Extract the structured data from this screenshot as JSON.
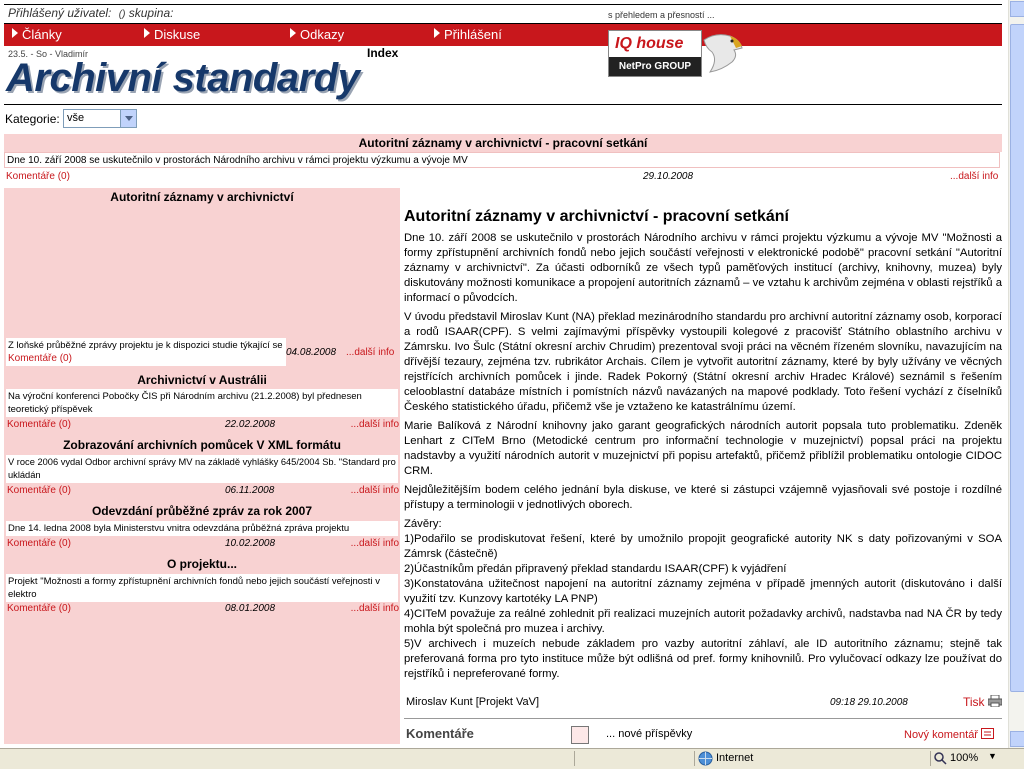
{
  "topbar": {
    "user_label": "Přihlášený uživatel:",
    "user_value": "()",
    "group_label": "skupina:",
    "motto": "s přehledem a přesností ..."
  },
  "nav": {
    "items": [
      "Články",
      "Diskuse",
      "Odkazy",
      "Přihlášení"
    ]
  },
  "header": {
    "date": "23.5. - So - Vladimír",
    "index_label": "Index",
    "title": "Archivní standardy"
  },
  "logo": {
    "brand": "IQ house",
    "sub": "NetPro GROUP"
  },
  "category": {
    "label": "Kategorie:",
    "selected": "vše"
  },
  "main_entry": {
    "title": "Autoritní záznamy v archivnictví - pracovní setkání",
    "snippet": "Dne 10. září 2008 se uskutečnilo v prostorách Národního archivu v rámci projektu výzkumu a vývoje MV",
    "comments": "Komentáře (0)",
    "date": "29.10.2008",
    "more": "...další info"
  },
  "left_entries": [
    {
      "title": "Autoritní záznamy v archivnictví",
      "snippet": "Z loňské průběžné zprávy projektu je k dispozici studie týkající se",
      "comments": "Komentáře (0)",
      "date": "04.08.2008",
      "more": "...další info"
    },
    {
      "title": "Archivnictví v Austrálii",
      "snippet": "Na výroční konferenci Pobočky ČIS při Národním archivu (21.2.2008) byl přednesen teoretický příspěvek",
      "comments": "Komentáře (0)",
      "date": "22.02.2008",
      "more": "...další info"
    },
    {
      "title": "Zobrazování archivních pomůcek V XML formátu",
      "snippet": "V roce 2006 vydal Odbor archivní správy MV na základě vyhlášky 645/2004 Sb. \"Standard pro ukládán",
      "comments": "Komentáře (0)",
      "date": "06.11.2008",
      "more": "...další info"
    },
    {
      "title": "Odevzdání průběžné zpráv za rok 2007",
      "snippet": "Dne 14. ledna 2008 byla Ministerstvu vnitra odevzdána průběžná zpráva projektu",
      "comments": "Komentáře (0)",
      "date": "10.02.2008",
      "more": "...další info"
    },
    {
      "title": "O projektu...",
      "snippet": "Projekt \"Možnosti a formy zpřístupnění archivních fondů nebo jejich součástí veřejnosti v elektro",
      "comments": "Komentáře (0)",
      "date": "08.01.2008",
      "more": "...další info"
    }
  ],
  "article": {
    "title": "Autoritní záznamy v archivnictví - pracovní setkání",
    "paragraphs": [
      "Dne 10. září 2008 se uskutečnilo v prostorách Národního archivu v rámci projektu výzkumu a vývoje MV \"Možnosti a formy zpřístupnění archivních fondů nebo jejich součástí veřejnosti v elektronické podobě\" pracovní setkání \"Autoritní záznamy v archivnictví\". Za účasti odborníků ze všech typů paměťových institucí (archivy, knihovny, muzea) byly diskutovány možnosti komunikace a propojení autoritních záznamů – ve vztahu k archivům zejména v oblasti rejstříků a informací o původcích.",
      "V úvodu představil Miroslav Kunt (NA) překlad mezinárodního standardu pro archivní autoritní záznamy osob, korporací a rodů ISAAR(CPF). S velmi zajímavými příspěvky vystoupili kolegové z pracovišť Státního oblastního archivu v Zámrsku. Ivo Šulc (Státní okresní archiv Chrudim) prezentoval svoji práci na věcném řízeném slovníku, navazujícím na dřívější tezaury, zejména tzv. rubrikátor Archais. Cílem je vytvořit autoritní záznamy, které by byly užívány ve věcných rejstřících archivních pomůcek i jinde. Radek Pokorný (Státní okresní archiv Hradec Králové) seznámil s řešením celoobla­stní databáze místních i pomístních názvů navázaných na mapové podklady. Toto řešení vychází z číselníků Českého statistického úřadu, přičemž vše je vztaženo ke katastrálnímu území.",
      "Marie Balíková z Národní knihovny jako garant geografických národních autorit popsala tuto problematiku. Zdeněk Lenhart z CITeM Brno (Metodické centrum pro informační technologie v muzejnictví) popsal práci na projektu nadstavby a využití národních autorit v muzejnictví při popisu artefaktů, přičemž přiblížil problematiku ontologie CIDOC CRM.",
      "Nejdůležitějším bodem celého jednání byla diskuse, ve které si zástupci vzájemně vyjasňovali své postoje i rozdílné přístupy a terminologii v jednotlivých oborech.",
      "Závěry:\n1)Podařilo se prodiskutovat řešení, které by umožnilo propojit geografické autority NK s daty pořizovanými v SOA Zámrsk (částečně)\n2)Účastníkům předán připravený překlad standardu ISAAR(CPF) k vyjádření\n3)Konstatována užitečnost napojení na autoritní záznamy zejména v případě jmenných autorit (diskutováno i další využití tzv. Kunzovy kartotéky LA PNP)\n4)CITeM považuje za reálné zohlednit při realizaci muzejních autorit požadavky archivů, nadstavba nad NA ČR by tedy mohla být společná pro muzea i archivy.\n5)V archivech i muzeích nebude základem pro vazby autoritní záhlaví, ale ID autoritního záznamu; stejně tak preferovaná forma pro tyto instituce může být odlišná od pref. formy knihovnilů. Pro vylučovací odkazy lze používat do rejstříků i nepreferované formy."
    ],
    "author": "Miroslav Kunt [Projekt VaV]",
    "datetime": "09:18 29.10.2008",
    "print_label": "Tisk"
  },
  "comments": {
    "label": "Komentáře",
    "new_posts": "...  nové příspěvky",
    "new_comment": "Nový komentář"
  },
  "statusbar": {
    "zone": "Internet",
    "zoom": "100%"
  },
  "colors": {
    "nav_red": "#c8171c",
    "pink": "#f8d2d2",
    "title_blue": "#16386a"
  }
}
